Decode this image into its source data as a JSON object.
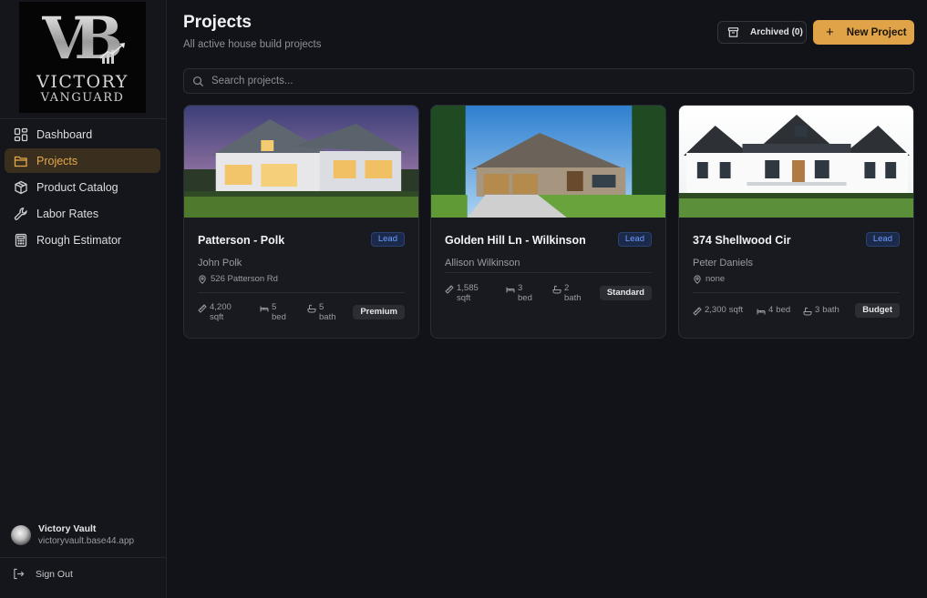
{
  "brand": {
    "monogram": "VB",
    "name_line1": "VICTORY",
    "name_line2": "VANGUARD"
  },
  "sidebar": {
    "items": [
      {
        "label": "Dashboard",
        "icon": "dashboard-grid-icon",
        "active": false
      },
      {
        "label": "Projects",
        "icon": "folder-icon",
        "active": true
      },
      {
        "label": "Product Catalog",
        "icon": "package-icon",
        "active": false
      },
      {
        "label": "Labor Rates",
        "icon": "wrench-icon",
        "active": false
      },
      {
        "label": "Rough Estimator",
        "icon": "calculator-icon",
        "active": false
      }
    ],
    "user": {
      "name": "Victory Vault",
      "email": "victoryvault.base44.app"
    },
    "signout_label": "Sign Out"
  },
  "header": {
    "title": "Projects",
    "subtitle": "All active house build projects",
    "archived_label": "Archived (0)",
    "new_project_label": "New Project"
  },
  "search": {
    "placeholder": "Search projects...",
    "value": ""
  },
  "projects": [
    {
      "title": "Patterson - Polk",
      "status": "Lead",
      "client": "John Polk",
      "address": "526 Patterson Rd",
      "sqft_value": "4,200",
      "sqft_unit": "sqft",
      "bed_value": "5",
      "bed_unit": "bed",
      "bath_value": "5",
      "bath_unit": "bath",
      "tier": "Premium"
    },
    {
      "title": "Golden Hill Ln - Wilkinson",
      "status": "Lead",
      "client": "Allison Wilkinson",
      "address": "",
      "sqft_value": "1,585",
      "sqft_unit": "sqft",
      "bed_value": "3",
      "bed_unit": "bed",
      "bath_value": "2",
      "bath_unit": "bath",
      "tier": "Standard"
    },
    {
      "title": "374 Shellwood Cir",
      "status": "Lead",
      "client": "Peter Daniels",
      "address": "none",
      "sqft_value": "2,300",
      "sqft_unit": "sqft",
      "bed_value": "4",
      "bed_unit": "bed",
      "bath_value": "3",
      "bath_unit": "bath",
      "tier": "Budget"
    }
  ],
  "colors": {
    "accent": "#e0a347",
    "background": "#121318",
    "badge_text": "#6f9dff"
  }
}
